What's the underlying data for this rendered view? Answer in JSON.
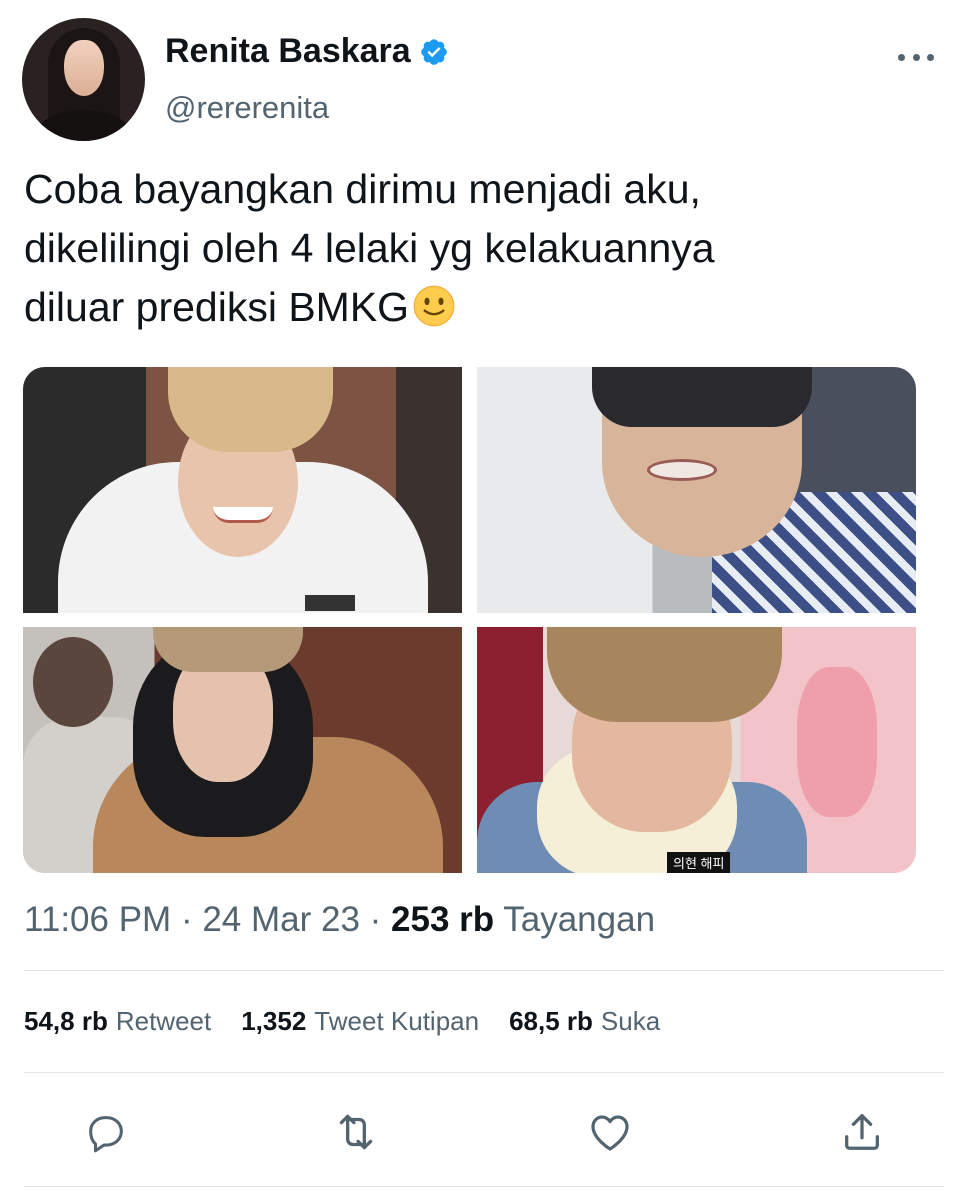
{
  "author": {
    "display_name": "Renita Baskara",
    "handle": "@rererenita",
    "verified": true
  },
  "tweet": {
    "text_lines": [
      "Coba bayangkan dirimu menjadi aku,",
      "dikelilingi oleh 4 lelaki yg kelakuannya",
      "diluar prediksi BMKG"
    ],
    "emoji": "slightly-smiling-face",
    "media_count": 4,
    "photo4_caption": "의현 해피"
  },
  "meta": {
    "time": "11:06 PM",
    "separator": " · ",
    "date": "24 Mar 23",
    "views_count": "253 rb",
    "views_label": "Tayangan"
  },
  "stats": {
    "retweets_count": "54,8 rb",
    "retweets_label": "Retweet",
    "quotes_count": "1,352",
    "quotes_label": "Tweet Kutipan",
    "likes_count": "68,5 rb",
    "likes_label": "Suka"
  },
  "actions": [
    "reply-icon",
    "retweet-icon",
    "like-icon",
    "share-icon"
  ],
  "colors": {
    "text": "#0f1419",
    "secondary": "#536471",
    "verified": "#1d9bf0",
    "divider": "#e1e6e9"
  }
}
